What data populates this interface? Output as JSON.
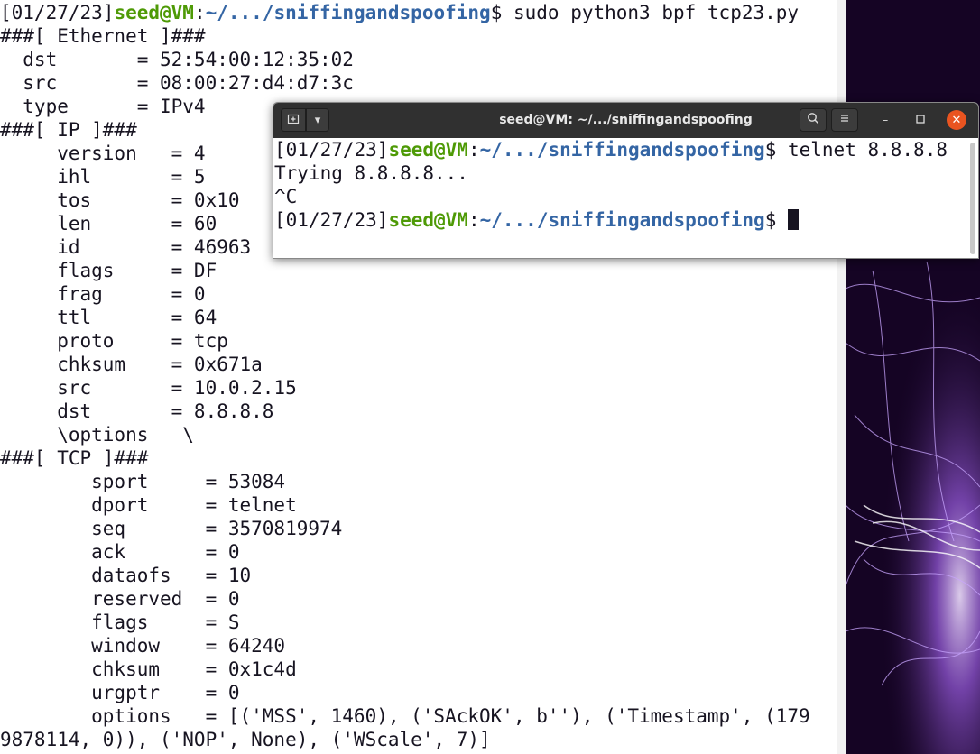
{
  "background_terminal": {
    "lines": [
      {
        "date": "[01/27/23]",
        "user": "seed@VM",
        "colon": ":",
        "path": "~/.../sniffingandspoofing",
        "rest": "$ sudo python3 bpf_tcp23.py"
      },
      {
        "text": "###[ Ethernet ]###"
      },
      {
        "text": "  dst       = 52:54:00:12:35:02"
      },
      {
        "text": "  src       = 08:00:27:d4:d7:3c"
      },
      {
        "text": "  type      = IPv4"
      },
      {
        "text": "###[ IP ]###"
      },
      {
        "text": "     version   = 4"
      },
      {
        "text": "     ihl       = 5"
      },
      {
        "text": "     tos       = 0x10"
      },
      {
        "text": "     len       = 60"
      },
      {
        "text": "     id        = 46963"
      },
      {
        "text": "     flags     = DF"
      },
      {
        "text": "     frag      = 0"
      },
      {
        "text": "     ttl       = 64"
      },
      {
        "text": "     proto     = tcp"
      },
      {
        "text": "     chksum    = 0x671a"
      },
      {
        "text": "     src       = 10.0.2.15"
      },
      {
        "text": "     dst       = 8.8.8.8"
      },
      {
        "text": "     \\options   \\"
      },
      {
        "text": "###[ TCP ]###"
      },
      {
        "text": "        sport     = 53084"
      },
      {
        "text": "        dport     = telnet"
      },
      {
        "text": "        seq       = 3570819974"
      },
      {
        "text": "        ack       = 0"
      },
      {
        "text": "        dataofs   = 10"
      },
      {
        "text": "        reserved  = 0"
      },
      {
        "text": "        flags     = S"
      },
      {
        "text": "        window    = 64240"
      },
      {
        "text": "        chksum    = 0x1c4d"
      },
      {
        "text": "        urgptr    = 0"
      },
      {
        "text": "        options   = [('MSS', 1460), ('SAckOK', b''), ('Timestamp', (179"
      },
      {
        "text": "9878114, 0)), ('NOP', None), ('WScale', 7)]"
      }
    ]
  },
  "front_window": {
    "title": "seed@VM: ~/.../sniffingandspoofing",
    "new_tab_icon": "new-tab-icon",
    "menu_arrow": "▾",
    "search_icon": "search-icon",
    "hamburger_icon": "menu-icon",
    "minimize": "–",
    "maximize": "□",
    "close": "✕",
    "lines": [
      {
        "date": "[01/27/23]",
        "user": "seed@VM",
        "colon": ":",
        "path": "~/.../sniffingandspoofing",
        "rest": "$ telnet 8.8.8.8"
      },
      {
        "text": "Trying 8.8.8.8..."
      },
      {
        "text": "^C"
      },
      {
        "date": "[01/27/23]",
        "user": "seed@VM",
        "colon": ":",
        "path": "~/.../sniffingandspoofing",
        "rest": "$ "
      }
    ]
  },
  "colors": {
    "prompt_user": "#4e9a06",
    "prompt_path": "#3465a4",
    "close_button": "#e95420"
  }
}
